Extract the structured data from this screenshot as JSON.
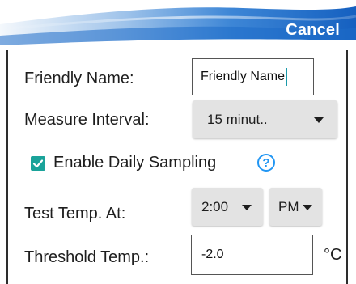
{
  "header": {
    "cancel_label": "Cancel",
    "gradient_colors": [
      "#ffffff",
      "#1565c0"
    ]
  },
  "form": {
    "friendly_name": {
      "label": "Friendly Name:",
      "value": "Friendly Name"
    },
    "measure_interval": {
      "label": "Measure Interval:",
      "selected": "15 minut.."
    },
    "daily_sampling": {
      "label": "Enable Daily Sampling",
      "checked": true,
      "help_icon": "question-circle-icon"
    },
    "test_temp": {
      "label": "Test Temp. At:",
      "time": "2:00",
      "period": "PM"
    },
    "threshold_temp": {
      "label": "Threshold Temp.:",
      "value": "-2.0",
      "unit": "°C"
    }
  },
  "colors": {
    "accent_teal": "#1aa39a",
    "help_blue": "#2196f3",
    "header_blue": "#1565c0"
  }
}
